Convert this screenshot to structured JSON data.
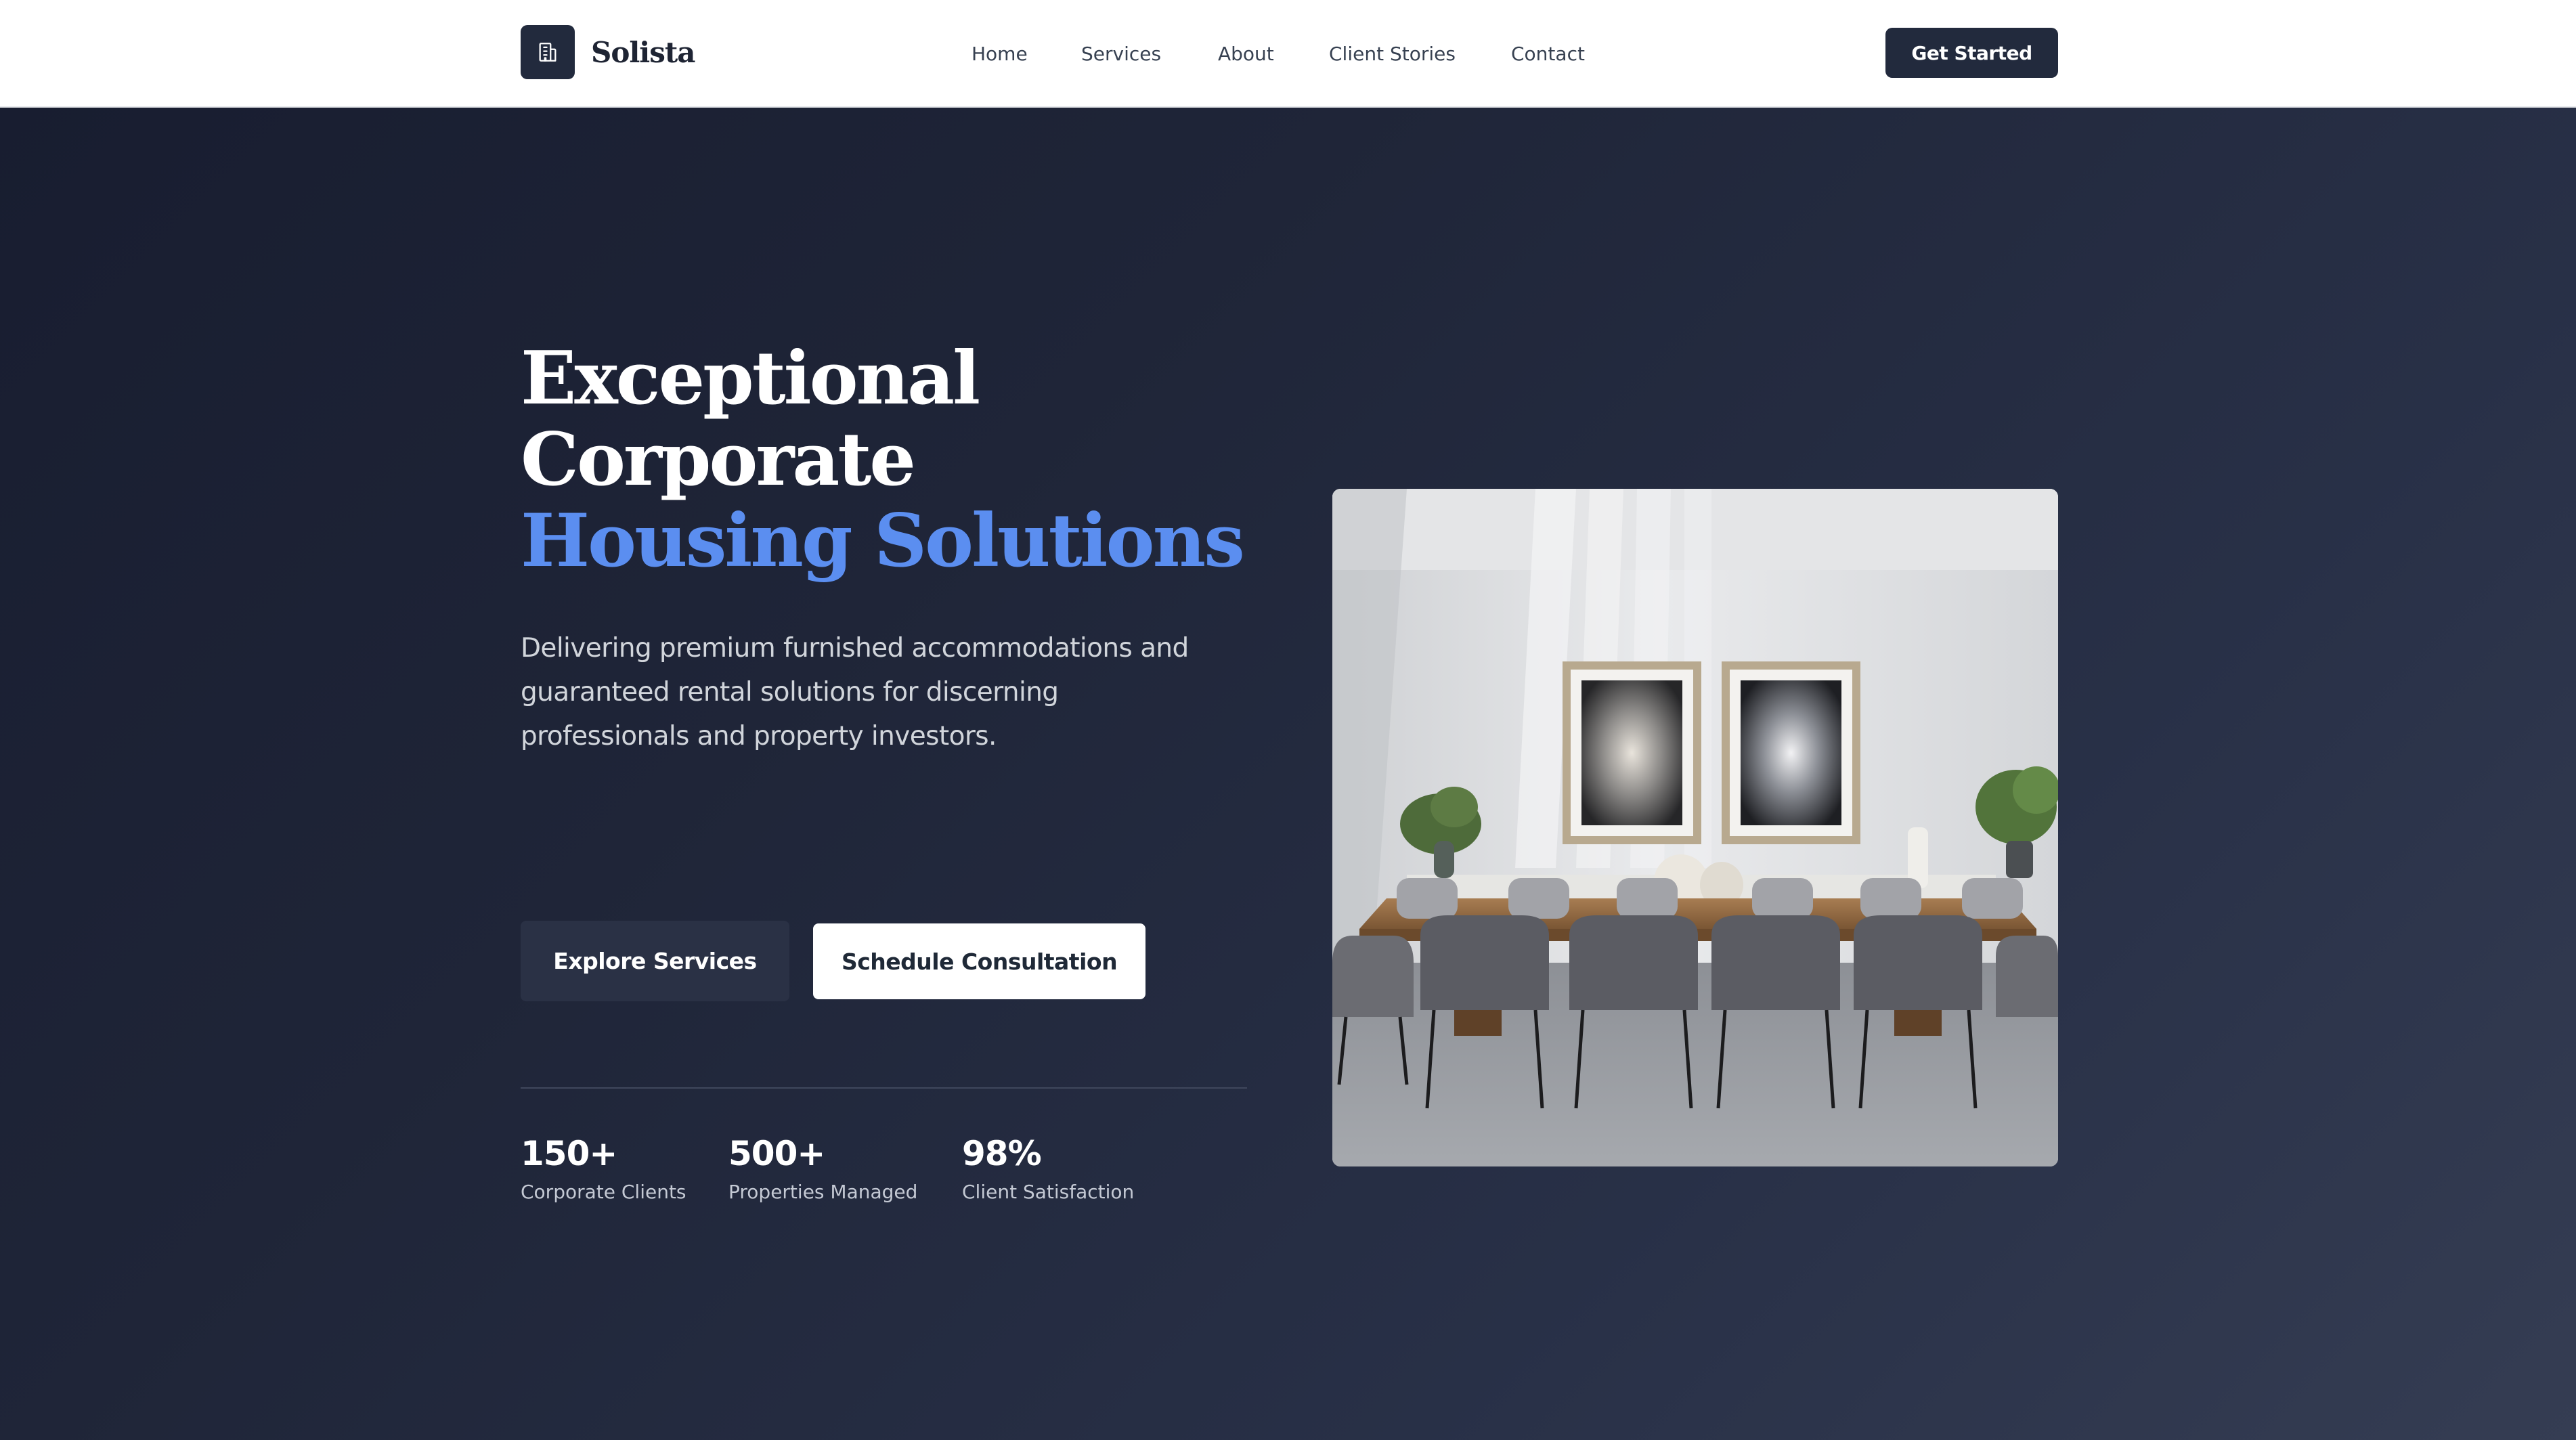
{
  "brand": {
    "name": "Solista",
    "logo_icon": "building-icon"
  },
  "nav": {
    "items": [
      {
        "label": "Home"
      },
      {
        "label": "Services"
      },
      {
        "label": "About"
      },
      {
        "label": "Client Stories"
      },
      {
        "label": "Contact"
      }
    ],
    "cta_label": "Get Started"
  },
  "hero": {
    "headline_line1": "Exceptional",
    "headline_line2": "Corporate",
    "headline_accent": "Housing Solutions",
    "subtitle": "Delivering premium furnished accommodations and guaranteed rental solutions for discerning professionals and property investors.",
    "primary_button": "Explore Services",
    "secondary_button": "Schedule Consultation",
    "stats": [
      {
        "value": "150+",
        "label": "Corporate Clients"
      },
      {
        "value": "500+",
        "label": "Properties Managed"
      },
      {
        "value": "98%",
        "label": "Client Satisfaction"
      }
    ],
    "image_subject": "furnished dining room with long wooden table, grey chairs and framed artwork"
  },
  "colors": {
    "brand_dark": "#222a3d",
    "accent_blue": "#5b8ef0",
    "hero_bg": "#1f2538",
    "white": "#ffffff"
  }
}
